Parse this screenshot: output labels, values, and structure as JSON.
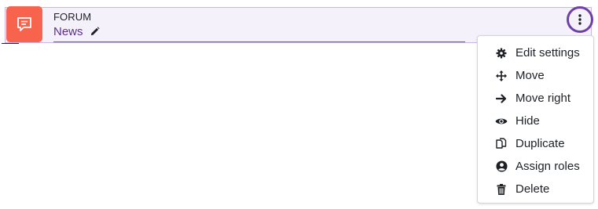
{
  "activity": {
    "type_label": "FORUM",
    "name": "News"
  },
  "menu": {
    "items": [
      {
        "label": "Edit settings",
        "icon": "gear-icon"
      },
      {
        "label": "Move",
        "icon": "move-arrows-icon"
      },
      {
        "label": "Move right",
        "icon": "arrow-right-icon"
      },
      {
        "label": "Hide",
        "icon": "eye-icon"
      },
      {
        "label": "Duplicate",
        "icon": "duplicate-icon"
      },
      {
        "label": "Assign roles",
        "icon": "user-circle-icon"
      },
      {
        "label": "Delete",
        "icon": "trash-icon"
      }
    ]
  },
  "colors": {
    "icon_bg": "#f7634d",
    "accent": "#6f3fa6",
    "link": "#5b2d8f",
    "row_bg": "#f4f1fa"
  }
}
